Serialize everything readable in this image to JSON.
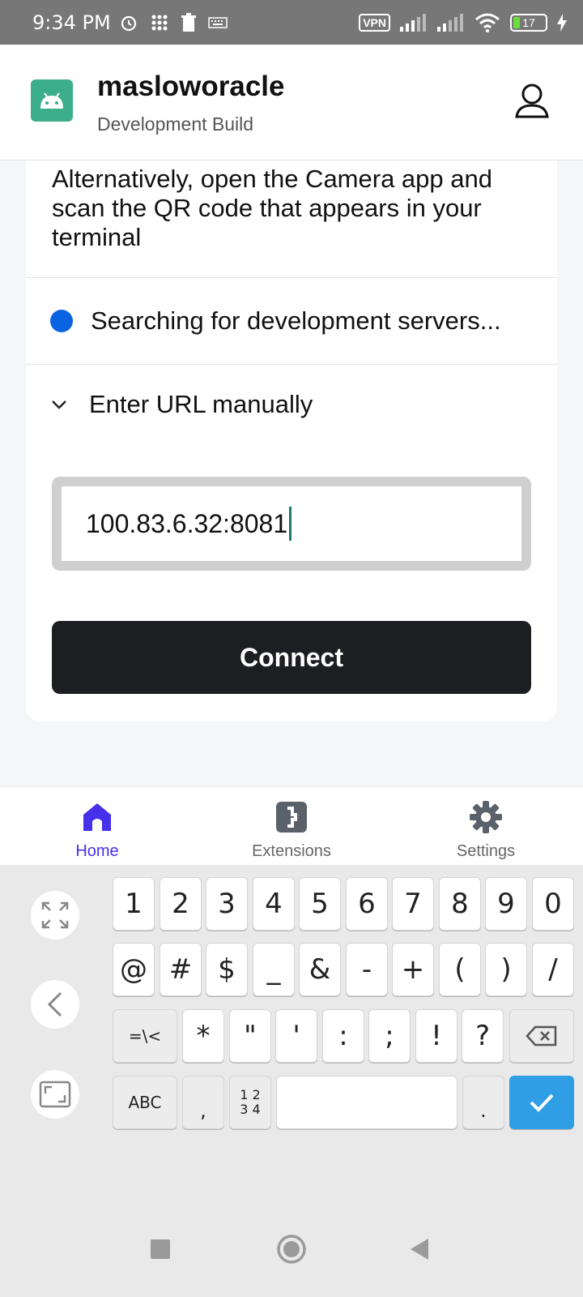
{
  "status_bar": {
    "time": "9:34 PM",
    "vpn": "VPN",
    "battery": "17"
  },
  "header": {
    "app_name": "masloworacle",
    "subtitle": "Development Build"
  },
  "content": {
    "alt_text": "Alternatively, open the Camera app and scan the QR code that appears in your terminal",
    "searching": "Searching for development servers...",
    "manual_label": "Enter URL manually",
    "url_value": "100.83.6.32:8081",
    "connect_label": "Connect"
  },
  "bottom_nav": [
    {
      "label": "Home",
      "icon": "home-icon",
      "active": true
    },
    {
      "label": "Extensions",
      "icon": "extensions-icon",
      "active": false
    },
    {
      "label": "Settings",
      "icon": "gear-icon",
      "active": false
    }
  ],
  "keyboard": {
    "row1": [
      "1",
      "2",
      "3",
      "4",
      "5",
      "6",
      "7",
      "8",
      "9",
      "0"
    ],
    "row2": [
      "@",
      "#",
      "$",
      "_",
      "&",
      "-",
      "+",
      "(",
      ")",
      "/"
    ],
    "row3": [
      "=\\<",
      "*",
      "\"",
      "'",
      ":",
      ";",
      "!",
      "?"
    ],
    "abc": "ABC",
    "comma": ",",
    "num_top": "1 2",
    "num_bottom": "3 4",
    "period": "."
  },
  "colors": {
    "accent": "#4630eb",
    "connect": "#1d1e22",
    "search_dot": "#0a63e0",
    "enter_key": "#2f9ee5",
    "app_icon": "#3cae8a"
  }
}
